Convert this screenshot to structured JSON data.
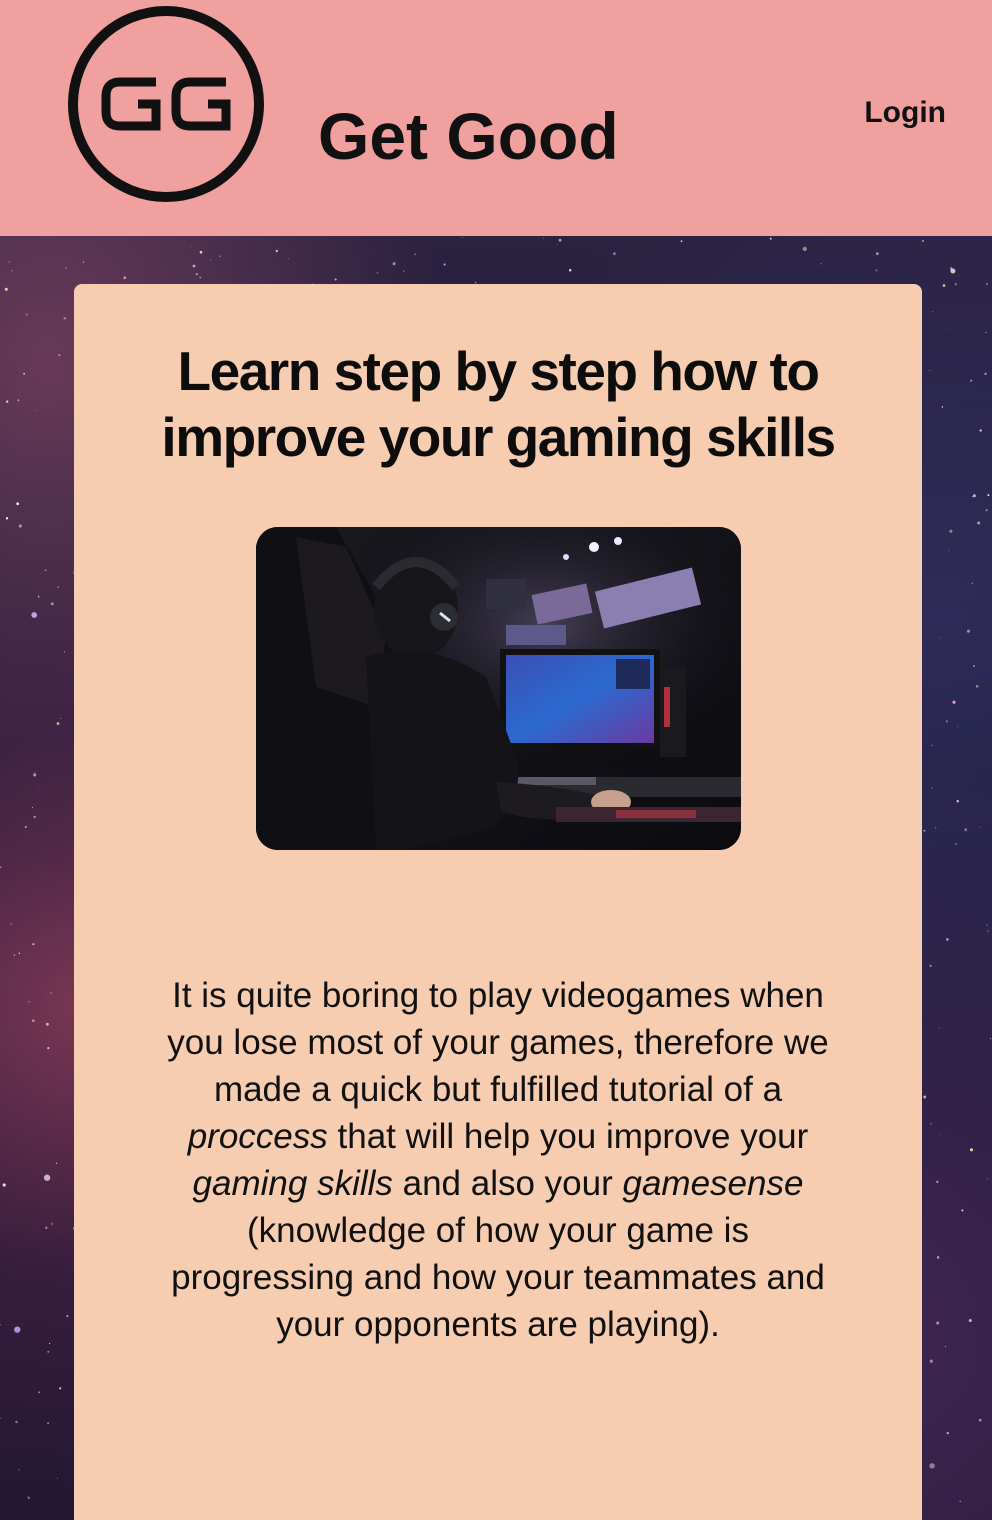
{
  "header": {
    "logo_text": "GG",
    "brand_name": "Get Good",
    "login_label": "Login"
  },
  "main": {
    "headline": "Learn step by step how to improve your gaming skills",
    "hero_image": {
      "description_icon": "gamer-at-esports-station-photo"
    },
    "intro": {
      "part1": "It is quite boring to play videogames when you lose most of your games, therefore we made a quick but fulfilled tutorial of a ",
      "em1": "proccess",
      "part2": " that will help you improve your ",
      "em2": "gaming skills",
      "part3": " and also your ",
      "em3": "gamesense",
      "part4": " (knowledge of how your game is progressing and how your teammates and your opponents are playing)."
    }
  },
  "colors": {
    "header_bg": "#f0a09e",
    "card_bg": "#f6cdb0",
    "text": "#111111"
  }
}
